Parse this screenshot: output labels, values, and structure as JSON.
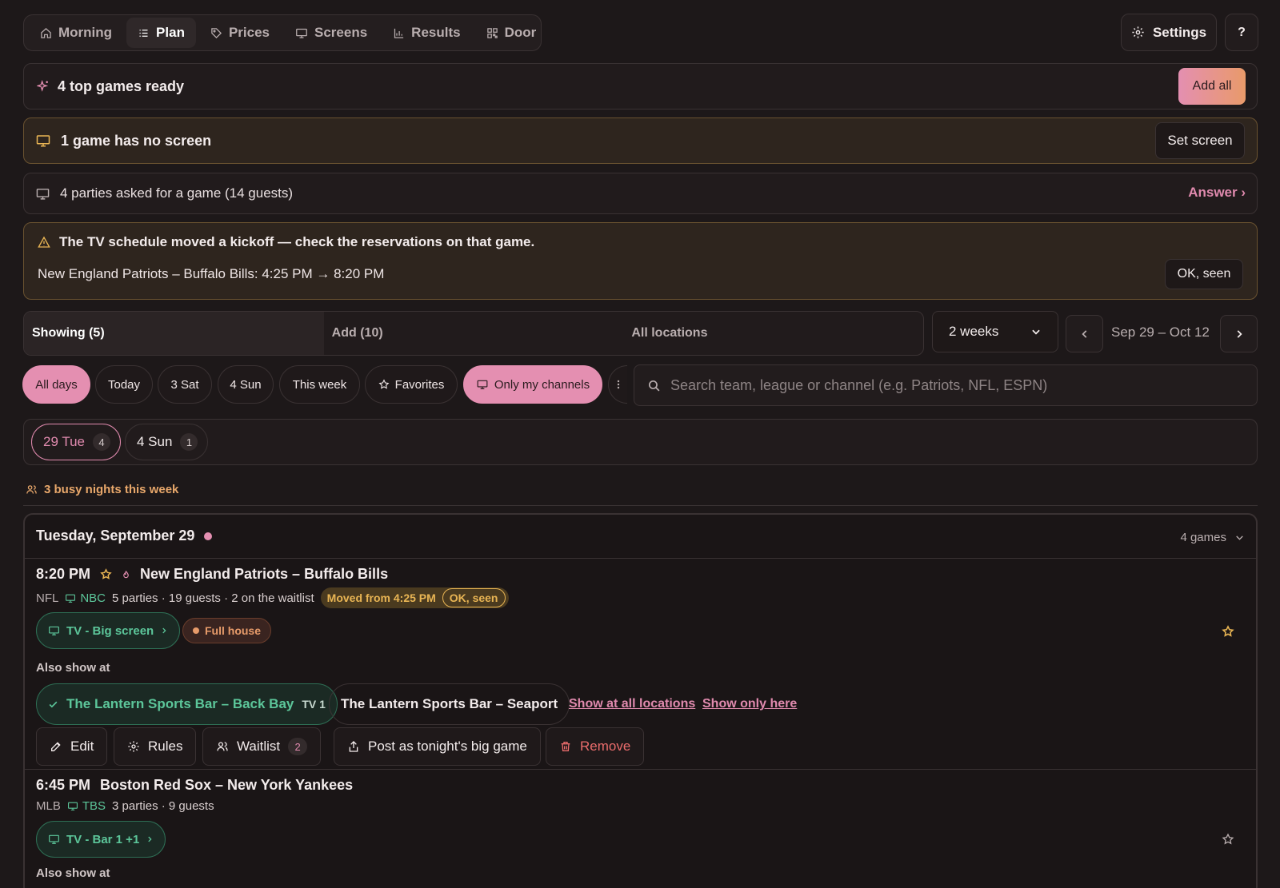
{
  "nav": {
    "tabs": [
      {
        "label": "Morning",
        "icon": "home-icon"
      },
      {
        "label": "Plan",
        "icon": "list-icon",
        "active": true
      },
      {
        "label": "Prices",
        "icon": "tag-icon"
      },
      {
        "label": "Screens",
        "icon": "monitor-icon"
      },
      {
        "label": "Results",
        "icon": "bar-chart-icon"
      },
      {
        "label": "Door",
        "icon": "qr-icon"
      }
    ],
    "settings_label": "Settings",
    "help_label": "?"
  },
  "banners": {
    "top_games": {
      "title": "4 top games ready",
      "action": "Add all"
    },
    "no_screen": {
      "title": "1 game has no screen",
      "action": "Set screen"
    },
    "requests": {
      "title": "4 parties asked for a game (14 guests)",
      "action": "Answer ›"
    },
    "schedule_change": {
      "title": "The TV schedule moved a kickoff — check the reservations on that game.",
      "detail": "New England Patriots – Buffalo Bills: 4:25 PM → 8:20 PM",
      "action": "OK, seen"
    }
  },
  "view": {
    "segments": [
      "Showing (5)",
      "Add (10)",
      "All locations"
    ],
    "range_select": "2 weeks",
    "date_range": "Sep 29 – Oct 12"
  },
  "filters": {
    "chips": [
      "All days",
      "Today",
      "3 Sat",
      "4 Sun",
      "This week",
      "Favorites",
      "Only my channels"
    ],
    "search_placeholder": "Search team, league or channel (e.g. Patriots, NFL, ESPN)"
  },
  "days": [
    {
      "label": "29 Tue",
      "count": "4"
    },
    {
      "label": "4 Sun",
      "count": "1"
    }
  ],
  "busy_nights": "3 busy nights this week",
  "day_card": {
    "heading": "Tuesday, September 29",
    "games_count": "4 games",
    "games": [
      {
        "time": "8:20 PM",
        "title": "New England Patriots – Buffalo Bills",
        "league": "NFL",
        "channel": "NBC",
        "info": "5 parties · 19 guests · 2 on the waitlist",
        "moved_label": "Moved from 4:25 PM",
        "moved_ack": "OK, seen",
        "screen": "TV - Big screen",
        "status": "Full house",
        "also_show_label": "Also show at",
        "locations": [
          {
            "name": "The Lantern Sports Bar – Back Bay",
            "tv": "TV 1",
            "selected": true
          },
          {
            "name": "The Lantern Sports Bar – Seaport",
            "selected": false
          }
        ],
        "links": [
          "Show at all locations",
          "Show only here"
        ],
        "actions": {
          "edit": "Edit",
          "rules": "Rules",
          "waitlist": "Waitlist",
          "waitlist_count": "2",
          "post": "Post as tonight's big game",
          "remove": "Remove"
        }
      },
      {
        "time": "6:45 PM",
        "title": "Boston Red Sox – New York Yankees",
        "league": "MLB",
        "channel": "TBS",
        "info": "3 parties · 9 guests",
        "screen": "TV - Bar 1 +1",
        "also_show_label": "Also show at"
      }
    ]
  },
  "colors": {
    "accent_pink": "#e48fb1",
    "accent_orange": "#e99a6a",
    "channel_green": "#5cc69a",
    "warning_amber": "#e9b554",
    "danger_red": "#ea6c6c",
    "background": "#1d1819"
  }
}
